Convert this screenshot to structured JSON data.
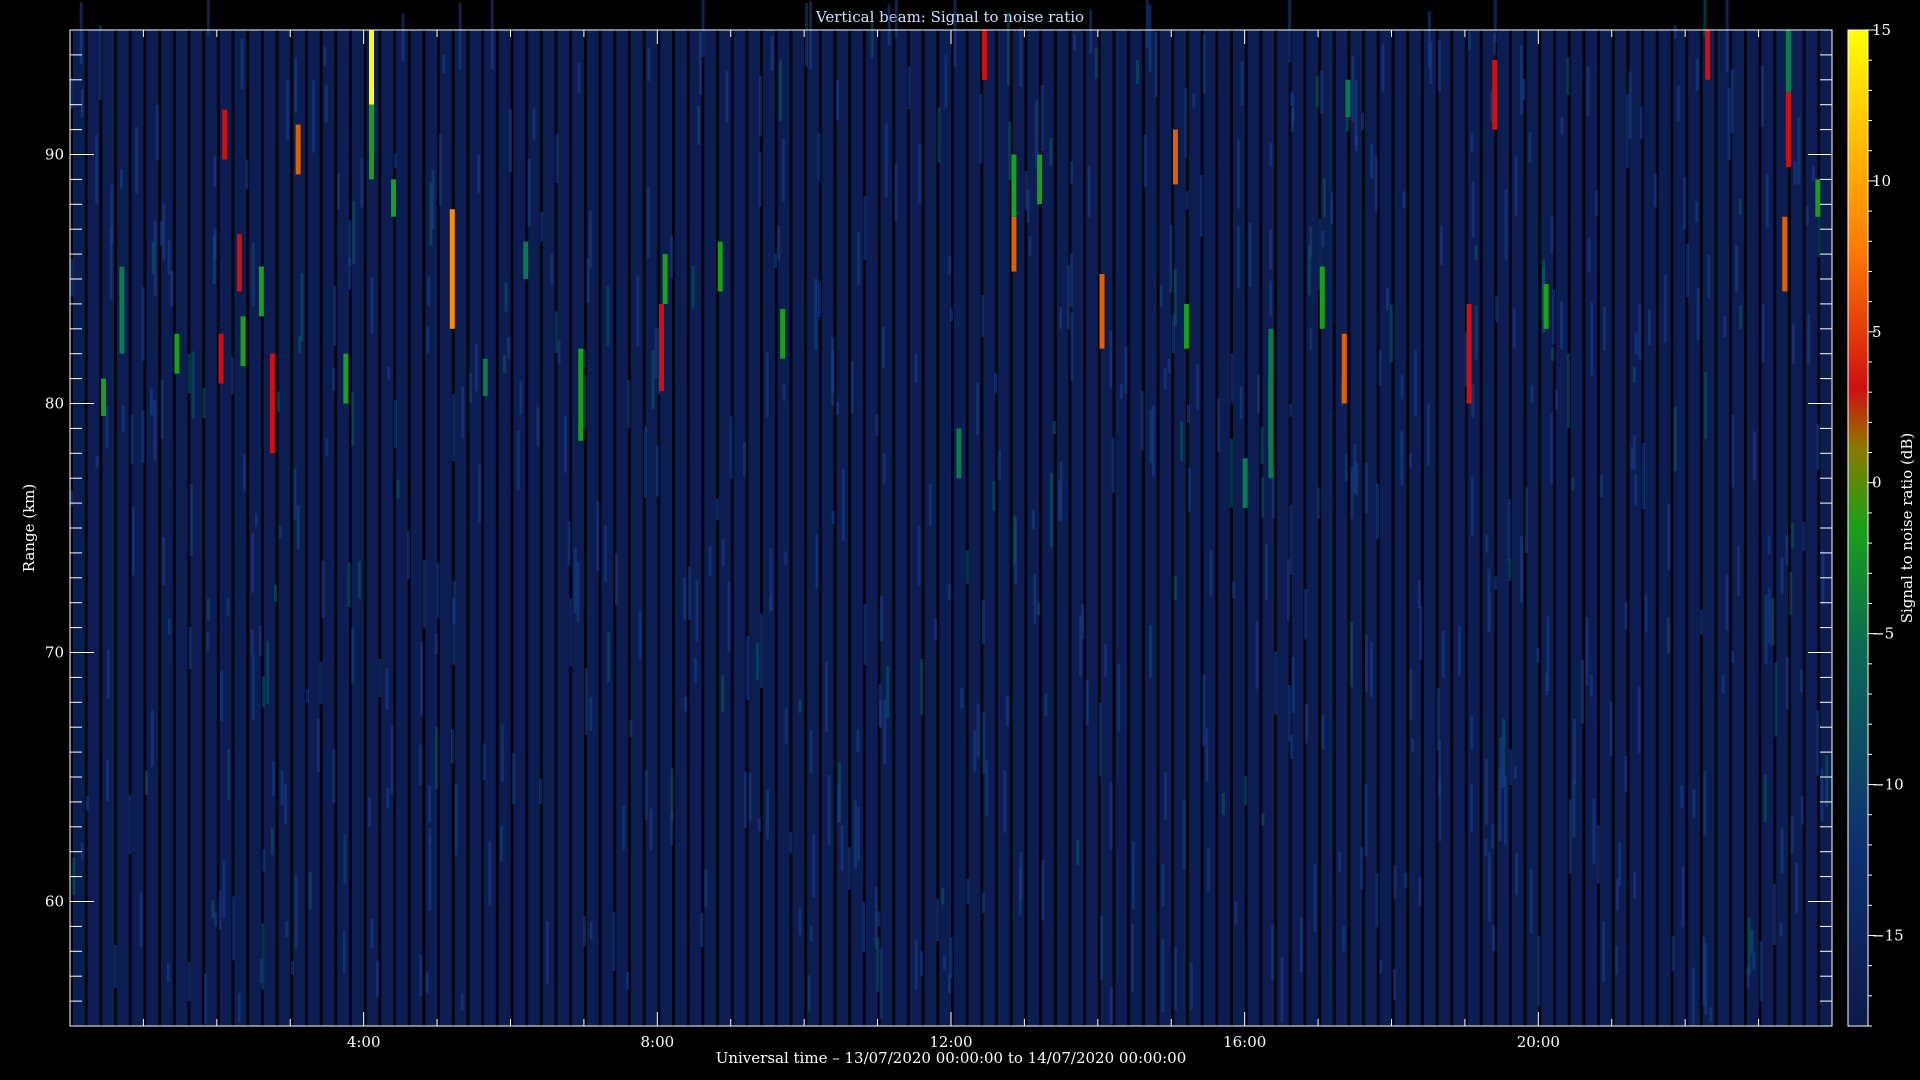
{
  "chart_data": {
    "type": "heatmap",
    "title": "Vertical beam: Signal to noise ratio",
    "xlabel": "Universal time – 13/07/2020 00:00:00 to 14/07/2020 00:00:00",
    "ylabel": "Range (km)",
    "colorbar_label": "Signal to noise ratio (dB)",
    "xlim": [
      0,
      24
    ],
    "ylim": [
      55,
      95
    ],
    "clim": [
      -18,
      15
    ],
    "x_ticks": [
      {
        "value": 4,
        "label": "4:00"
      },
      {
        "value": 8,
        "label": "8:00"
      },
      {
        "value": 12,
        "label": "12:00"
      },
      {
        "value": 16,
        "label": "16:00"
      },
      {
        "value": 20,
        "label": "20:00"
      }
    ],
    "y_ticks": [
      {
        "value": 60,
        "label": "60"
      },
      {
        "value": 70,
        "label": "70"
      },
      {
        "value": 80,
        "label": "80"
      },
      {
        "value": 90,
        "label": "90"
      }
    ],
    "colorbar_ticks": [
      {
        "value": 15,
        "label": "15"
      },
      {
        "value": 10,
        "label": "10"
      },
      {
        "value": 5,
        "label": "5"
      },
      {
        "value": 0,
        "label": "0"
      },
      {
        "value": -5,
        "label": "−5"
      },
      {
        "value": -10,
        "label": "−10"
      },
      {
        "value": -15,
        "label": "−15"
      }
    ],
    "colormap": [
      "#0b1a4a",
      "#0f2f70",
      "#107a3a",
      "#18a018",
      "#d01010",
      "#ff8800",
      "#ffff00"
    ],
    "background_noise_db": -15,
    "time_bin_hours": 0.2,
    "echoes": [
      {
        "t": 0.45,
        "r0": 79.5,
        "r1": 81.0,
        "snr": -6
      },
      {
        "t": 0.7,
        "r0": 82.0,
        "r1": 85.5,
        "snr": -7
      },
      {
        "t": 1.45,
        "r0": 81.2,
        "r1": 82.8,
        "snr": -5
      },
      {
        "t": 2.05,
        "r0": 80.8,
        "r1": 82.8,
        "snr": 0
      },
      {
        "t": 2.1,
        "r0": 89.8,
        "r1": 91.8,
        "snr": 0
      },
      {
        "t": 2.3,
        "r0": 84.5,
        "r1": 86.8,
        "snr": -1
      },
      {
        "t": 2.35,
        "r0": 81.5,
        "r1": 83.5,
        "snr": -6
      },
      {
        "t": 2.6,
        "r0": 83.5,
        "r1": 85.5,
        "snr": -6
      },
      {
        "t": 2.75,
        "r0": 78.0,
        "r1": 82.0,
        "snr": -1
      },
      {
        "t": 3.1,
        "r0": 89.2,
        "r1": 91.2,
        "snr": 2
      },
      {
        "t": 3.75,
        "r0": 80.0,
        "r1": 82.0,
        "snr": -6
      },
      {
        "t": 4.1,
        "r0": 92.0,
        "r1": 95.0,
        "snr": 14
      },
      {
        "t": 4.1,
        "r0": 89.0,
        "r1": 92.0,
        "snr": -4
      },
      {
        "t": 4.4,
        "r0": 87.5,
        "r1": 89.0,
        "snr": -5
      },
      {
        "t": 5.2,
        "r0": 83.0,
        "r1": 87.8,
        "snr": 9
      },
      {
        "t": 5.65,
        "r0": 80.3,
        "r1": 81.8,
        "snr": -7
      },
      {
        "t": 6.2,
        "r0": 85.0,
        "r1": 86.5,
        "snr": -8
      },
      {
        "t": 6.95,
        "r0": 78.5,
        "r1": 82.2,
        "snr": -6
      },
      {
        "t": 8.05,
        "r0": 80.5,
        "r1": 84.0,
        "snr": 0
      },
      {
        "t": 8.1,
        "r0": 84.0,
        "r1": 86.0,
        "snr": -5
      },
      {
        "t": 8.85,
        "r0": 84.5,
        "r1": 86.5,
        "snr": -6
      },
      {
        "t": 9.7,
        "r0": 81.8,
        "r1": 83.8,
        "snr": -5
      },
      {
        "t": 12.1,
        "r0": 77.0,
        "r1": 79.0,
        "snr": -7
      },
      {
        "t": 12.45,
        "r0": 93.0,
        "r1": 95.0,
        "snr": -1
      },
      {
        "t": 12.85,
        "r0": 85.3,
        "r1": 87.5,
        "snr": 5
      },
      {
        "t": 12.85,
        "r0": 87.5,
        "r1": 90.0,
        "snr": -5
      },
      {
        "t": 13.2,
        "r0": 88.0,
        "r1": 90.0,
        "snr": -6
      },
      {
        "t": 14.05,
        "r0": 82.2,
        "r1": 85.2,
        "snr": 5
      },
      {
        "t": 15.05,
        "r0": 88.8,
        "r1": 91.0,
        "snr": 3
      },
      {
        "t": 15.2,
        "r0": 82.2,
        "r1": 84.0,
        "snr": -5
      },
      {
        "t": 16.0,
        "r0": 75.8,
        "r1": 77.8,
        "snr": -9
      },
      {
        "t": 16.35,
        "r0": 77.0,
        "r1": 83.0,
        "snr": -8
      },
      {
        "t": 17.05,
        "r0": 83.0,
        "r1": 85.5,
        "snr": -4
      },
      {
        "t": 17.35,
        "r0": 80.0,
        "r1": 82.8,
        "snr": 5
      },
      {
        "t": 17.4,
        "r0": 91.5,
        "r1": 93.0,
        "snr": -8
      },
      {
        "t": 19.05,
        "r0": 80.0,
        "r1": 84.0,
        "snr": -2
      },
      {
        "t": 19.4,
        "r0": 91.0,
        "r1": 93.8,
        "snr": 1
      },
      {
        "t": 20.1,
        "r0": 83.0,
        "r1": 84.8,
        "snr": -5
      },
      {
        "t": 22.3,
        "r0": 93.0,
        "r1": 95.0,
        "snr": -2
      },
      {
        "t": 23.35,
        "r0": 84.5,
        "r1": 87.5,
        "snr": 4
      },
      {
        "t": 23.4,
        "r0": 89.5,
        "r1": 92.5,
        "snr": 1
      },
      {
        "t": 23.4,
        "r0": 92.5,
        "r1": 95.0,
        "snr": -7
      },
      {
        "t": 23.8,
        "r0": 87.5,
        "r1": 89.0,
        "snr": -6
      }
    ]
  }
}
